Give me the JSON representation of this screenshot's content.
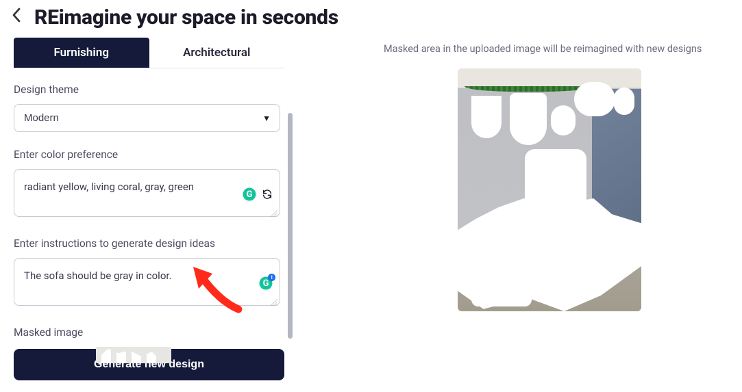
{
  "header": {
    "title": "REimagine your space in seconds"
  },
  "tabs": {
    "furnishing": "Furnishing",
    "architectural": "Architectural"
  },
  "form": {
    "theme_label": "Design theme",
    "theme_value": "Modern",
    "color_label": "Enter color preference",
    "color_value": "radiant yellow, living coral, gray, green",
    "instructions_label": "Enter instructions to generate design ideas",
    "instructions_value": "The sofa should be gray in color.",
    "masked_label": "Masked image"
  },
  "actions": {
    "generate": "Generate new design"
  },
  "right": {
    "hint": "Masked area in the uploaded image will be reimagined with new designs"
  },
  "grammarly": {
    "notif_count": "1"
  }
}
